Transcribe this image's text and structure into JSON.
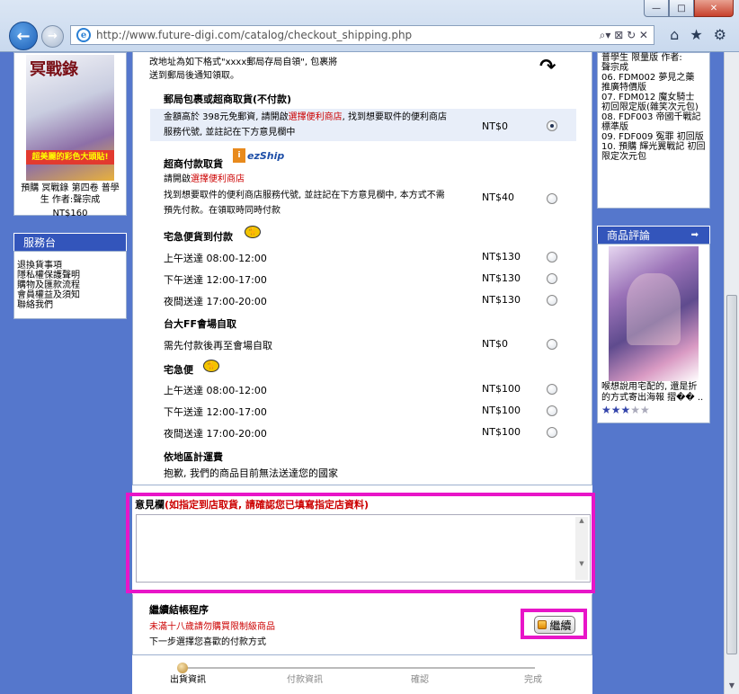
{
  "browser": {
    "url": "http://www.future-digi.com/catalog/checkout_shipping.php",
    "minimize": "—",
    "maximize": "□",
    "close": "✕",
    "addr_tools": "⌕▾ ⊠ ↻ ✕"
  },
  "left": {
    "cover_title": "冥戰錄",
    "cover_band": "超美麗的彩色大頭貼!",
    "book_caption": "預購 冥戰錄 第四卷 普學生 作者:聲宗成",
    "book_price": "NT$160",
    "service_title": "服務台",
    "service_links": [
      "退換貨事項",
      "隱私權保護聲明",
      "購物及匯款流程",
      "會員權益及須知",
      "聯絡我們"
    ]
  },
  "main": {
    "intro_line1": "改地址為如下格式\"xxxx郵局存局自領\", 包裹將",
    "intro_line2": "送到郵局後通知領取。",
    "arrow": "↷",
    "post": {
      "title": "郵局包裹或超商取貨(不付款)",
      "desc_a": "金額高於 398元免郵資, 請開啟",
      "desc_link": "選擇便利商店",
      "desc_b": ", 找到想要取件的便利商店",
      "desc_c": "服務代號, 並註記在下方意見欄中",
      "price": "NT$0"
    },
    "cvs": {
      "title": "超商付款取貨",
      "logo_box": "i",
      "logo_text": "ezShip",
      "link_pre": "請開啟",
      "link": "選擇便利商店",
      "desc_a": "找到想要取件的便利商店服務代號, 並註記在下方意見欄中, 本方式不需",
      "desc_b": "預先付款。在領取時同時付款",
      "price": "NT$40"
    },
    "cod": {
      "title": "宅急便貨到付款",
      "rows": [
        {
          "label": "上午送達 08:00-12:00",
          "price": "NT$130"
        },
        {
          "label": "下午送達 12:00-17:00",
          "price": "NT$130"
        },
        {
          "label": "夜間送達 17:00-20:00",
          "price": "NT$130"
        }
      ]
    },
    "ff": {
      "title": "台大FF會場自取",
      "desc": "需先付款後再至會場自取",
      "price": "NT$0"
    },
    "tqb": {
      "title": "宅急便",
      "rows": [
        {
          "label": "上午送達 08:00-12:00",
          "price": "NT$100"
        },
        {
          "label": "下午送達 12:00-17:00",
          "price": "NT$100"
        },
        {
          "label": "夜間送達 17:00-20:00",
          "price": "NT$100"
        }
      ]
    },
    "region": {
      "title": "依地區計運費",
      "desc": "抱歉, 我們的商品目前無法送達您的國家"
    },
    "notes": {
      "label": "意見欄",
      "hint": "(如指定到店取貨, 請確認您已填寫指定店資料)",
      "value": ""
    },
    "cont": {
      "title": "繼續結帳程序",
      "warn": "未滿十八歲請勿購買限制級商品",
      "next": "下一步選擇您喜歡的付款方式",
      "button": "繼續"
    },
    "steps": [
      "出貨資訊",
      "付款資訊",
      "確認",
      "完成"
    ]
  },
  "right": {
    "list": [
      "普學生 限量版 作者:",
      "聲宗成",
      "06. FDM002 夢見之藥 推廣特價版",
      "07. FDM012 魔女騎士 初回限定版(雜笑次元包)",
      "08. FDF003 帝國千戰記 標準版",
      "09. FDF009 冤罪 初回版",
      "10. 預購 輝光翼戰記 初回限定次元包"
    ],
    "review_title": "商品評論",
    "review_arrow": "➡",
    "review_text": "喉想說用宅配的, 還是折的方式寄出海報 摺�� ..",
    "stars_on": "★★★",
    "stars_off": "★★"
  }
}
